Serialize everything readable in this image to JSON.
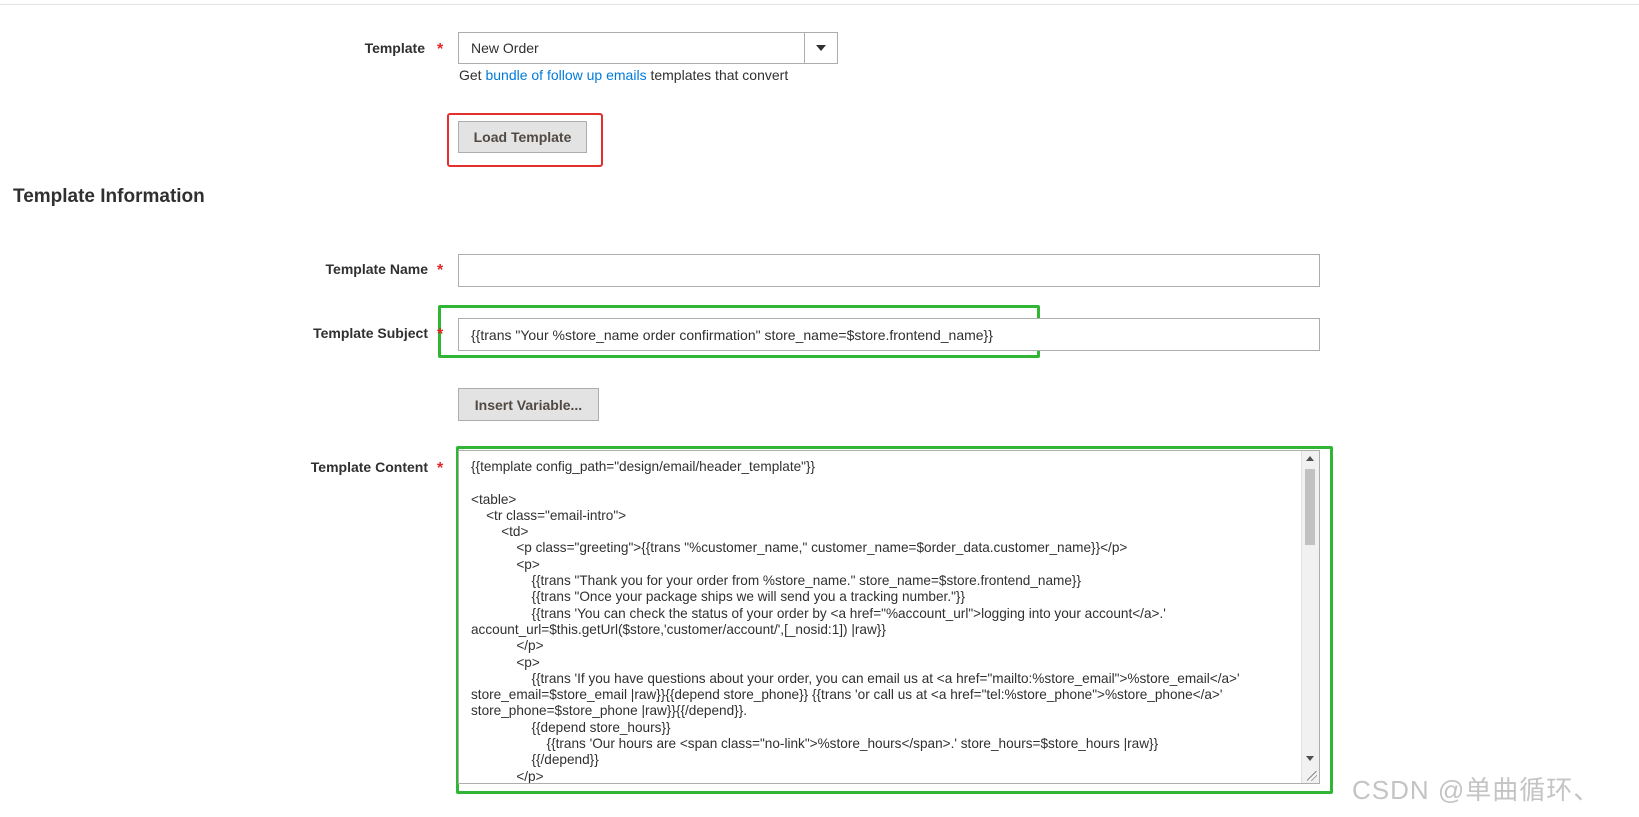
{
  "template_field": {
    "label": "Template",
    "required_mark": "*",
    "selected": "New Order"
  },
  "promo_note": {
    "prefix": "Get ",
    "link_text": "bundle of follow up emails",
    "suffix": " templates that convert"
  },
  "load_button": {
    "label": "Load Template"
  },
  "section": {
    "title": "Template Information"
  },
  "template_name": {
    "label": "Template Name",
    "required_mark": "*",
    "value": ""
  },
  "template_subject": {
    "label": "Template Subject",
    "required_mark": "*",
    "value": "{{trans \"Your %store_name order confirmation\" store_name=$store.frontend_name}}"
  },
  "insert_variable": {
    "label": "Insert Variable..."
  },
  "template_content": {
    "label": "Template Content",
    "required_mark": "*",
    "value": "{{template config_path=\"design/email/header_template\"}}\n\n<table>\n    <tr class=\"email-intro\">\n        <td>\n            <p class=\"greeting\">{{trans \"%customer_name,\" customer_name=$order_data.customer_name}}</p>\n            <p>\n                {{trans \"Thank you for your order from %store_name.\" store_name=$store.frontend_name}}\n                {{trans \"Once your package ships we will send you a tracking number.\"}}\n                {{trans 'You can check the status of your order by <a href=\"%account_url\">logging into your account</a>.' account_url=$this.getUrl($store,'customer/account/',[_nosid:1]) |raw}}\n            </p>\n            <p>\n                {{trans 'If you have questions about your order, you can email us at <a href=\"mailto:%store_email\">%store_email</a>' store_email=$store_email |raw}}{{depend store_phone}} {{trans 'or call us at <a href=\"tel:%store_phone\">%store_phone</a>' store_phone=$store_phone |raw}}{{/depend}}.\n                {{depend store_hours}}\n                    {{trans 'Our hours are <span class=\"no-link\">%store_hours</span>.' store_hours=$store_hours |raw}}\n                {{/depend}}\n            </p>"
  },
  "watermark": {
    "text": "CSDN @单曲循环、"
  },
  "colors": {
    "required": "#e22626",
    "link": "#007bdb",
    "highlight_red": "#e52e2e",
    "highlight_green": "#31b534",
    "button_bg": "#e3e3e3"
  }
}
